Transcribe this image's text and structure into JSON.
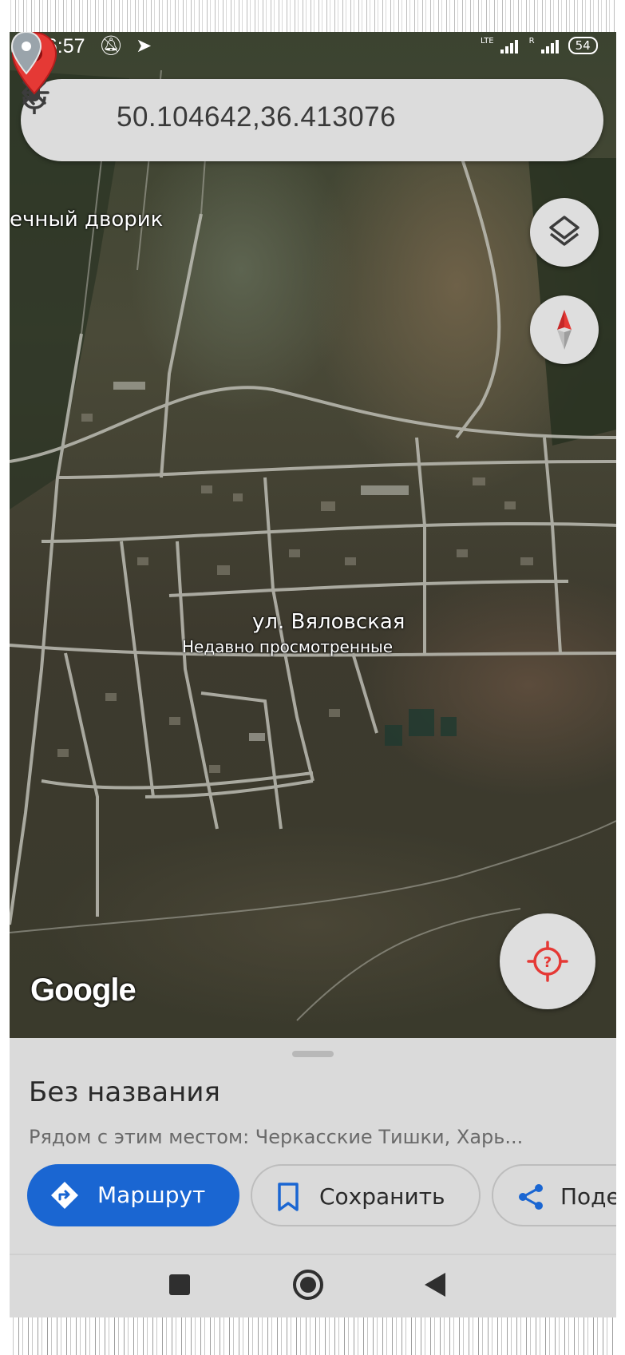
{
  "status_bar": {
    "time": "16:57",
    "left_icons": [
      "bell-off-icon",
      "telegram-icon"
    ],
    "network_label_1": "LTE",
    "network_label_2": "R",
    "battery": "54"
  },
  "search": {
    "query": "50.104642,36.413076",
    "back_icon": "arrow-back-icon",
    "clear_icon": "close-icon",
    "mic_icon": "mic-icon"
  },
  "map": {
    "labels": {
      "place1": "ечный дворик",
      "street": "ул. Вяловская",
      "recent": "Недавно просмотренные"
    },
    "attribution": "Google",
    "controls": [
      "layers-icon",
      "compass-icon",
      "my-location-icon"
    ],
    "pin_color": "#e53935"
  },
  "sheet": {
    "title": "Без названия",
    "subtitle": "Рядом с этим местом: Черкасские Тишки, Харь...",
    "buttons": {
      "route": "Маршрут",
      "save": "Сохранить",
      "share": "Поде"
    },
    "accent": "#1a66d2"
  },
  "navbar": {
    "buttons": [
      "recents-square-icon",
      "home-circle-icon",
      "back-triangle-icon"
    ]
  }
}
